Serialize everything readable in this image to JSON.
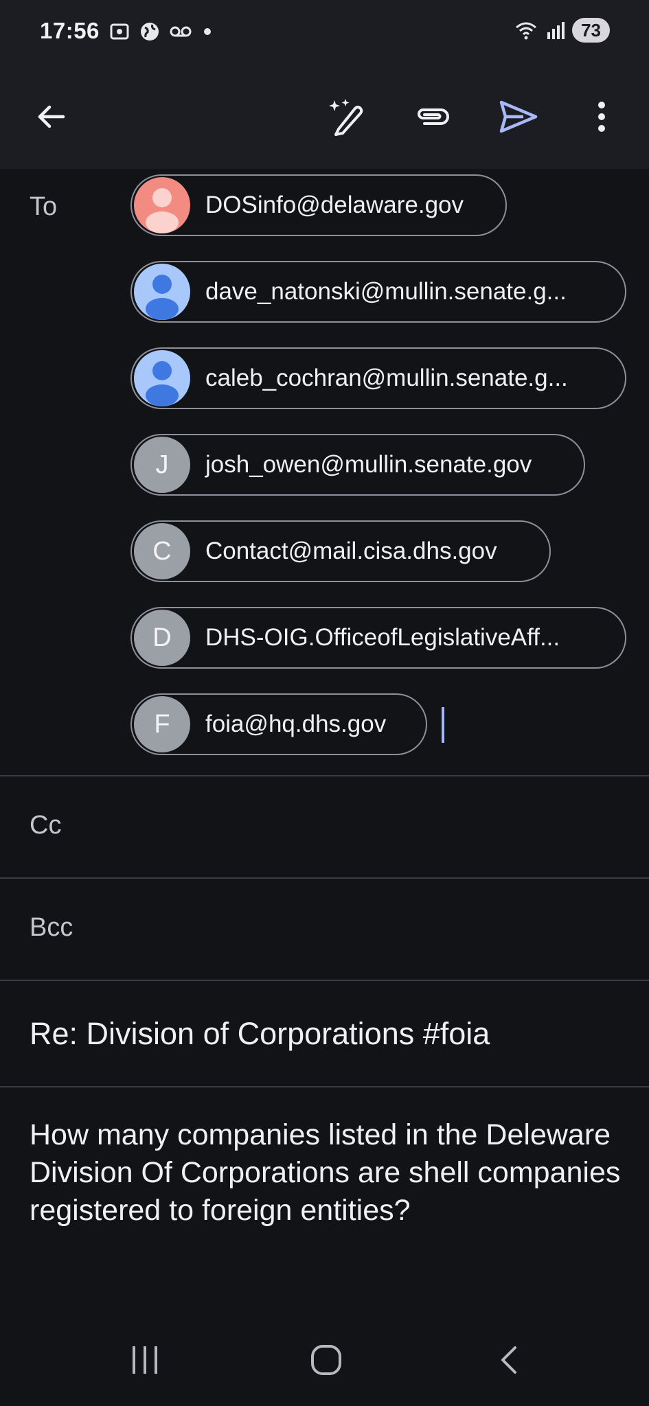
{
  "status_bar": {
    "time": "17:56",
    "battery": "73",
    "icons_left": [
      "screenshot-icon",
      "globe-icon",
      "voicemail-icon",
      "dot-icon"
    ],
    "icons_right": [
      "wifi-icon",
      "signal-icon"
    ]
  },
  "app_bar": {
    "icons": [
      "back-arrow-icon",
      "magic-pen-icon",
      "attachment-icon",
      "send-icon",
      "more-vert-icon"
    ]
  },
  "to": {
    "label": "To",
    "recipients": [
      {
        "initial": "",
        "address": "DOSinfo@delaware.gov",
        "avatar_color": "#f28b82",
        "avatar_type": "person"
      },
      {
        "initial": "",
        "address": "dave_natonski@mullin.senate.g...",
        "avatar_color": "#a8c7fa",
        "avatar_type": "person"
      },
      {
        "initial": "",
        "address": "caleb_cochran@mullin.senate.g...",
        "avatar_color": "#a8c7fa",
        "avatar_type": "person"
      },
      {
        "initial": "J",
        "address": "josh_owen@mullin.senate.gov",
        "avatar_color": "#9aa0a6",
        "avatar_type": "letter"
      },
      {
        "initial": "C",
        "address": "Contact@mail.cisa.dhs.gov",
        "avatar_color": "#9aa0a6",
        "avatar_type": "letter"
      },
      {
        "initial": "D",
        "address": "DHS-OIG.OfficeofLegislativeAff...",
        "avatar_color": "#9aa0a6",
        "avatar_type": "letter"
      },
      {
        "initial": "F",
        "address": "foia@hq.dhs.gov",
        "avatar_color": "#9aa0a6",
        "avatar_type": "letter"
      }
    ]
  },
  "cc": {
    "label": "Cc"
  },
  "bcc": {
    "label": "Bcc"
  },
  "subject": "Re: Division of Corporations #foia",
  "body": "How many companies listed in the Deleware Division Of Corporations are shell companies registered to foreign entities?",
  "nav_bar": {
    "icons": [
      "recents-icon",
      "home-icon",
      "back-icon"
    ]
  }
}
